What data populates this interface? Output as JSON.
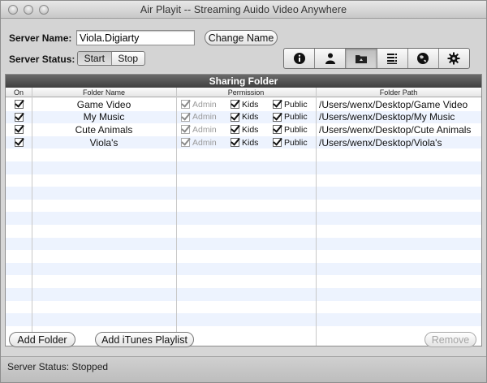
{
  "window": {
    "title": "Air Playit -- Streaming Auido Video Anywhere"
  },
  "server": {
    "name_label": "Server Name:",
    "name_value": "Viola.Digiarty",
    "change_name_button": "Change Name",
    "status_label": "Server Status:",
    "start_label": "Start",
    "stop_label": "Stop"
  },
  "toolbar": {
    "icons": [
      "info-icon",
      "user-icon",
      "folder-icon",
      "list-icon",
      "globe-icon",
      "gear-icon"
    ],
    "active_index": 2
  },
  "panel": {
    "header": "Sharing Folder",
    "columns": {
      "on": "On",
      "folder_name": "Folder Name",
      "permission": "Permission",
      "folder_path": "Folder Path"
    },
    "permission_labels": {
      "admin": "Admin",
      "kids": "Kids",
      "public": "Public"
    },
    "rows": [
      {
        "on": true,
        "name": "Game Video",
        "admin": true,
        "kids": true,
        "public": true,
        "path": "/Users/wenx/Desktop/Game Video"
      },
      {
        "on": true,
        "name": "My Music",
        "admin": true,
        "kids": true,
        "public": true,
        "path": "/Users/wenx/Desktop/My Music"
      },
      {
        "on": true,
        "name": "Cute Animals",
        "admin": true,
        "kids": true,
        "public": true,
        "path": "/Users/wenx/Desktop/Cute Animals"
      },
      {
        "on": true,
        "name": "Viola's",
        "admin": true,
        "kids": true,
        "public": true,
        "path": "/Users/wenx/Desktop/Viola's"
      }
    ]
  },
  "buttons": {
    "add_folder": "Add Folder",
    "add_itunes": "Add iTunes Playlist",
    "remove": "Remove"
  },
  "statusbar": {
    "text": "Server Status: Stopped"
  }
}
